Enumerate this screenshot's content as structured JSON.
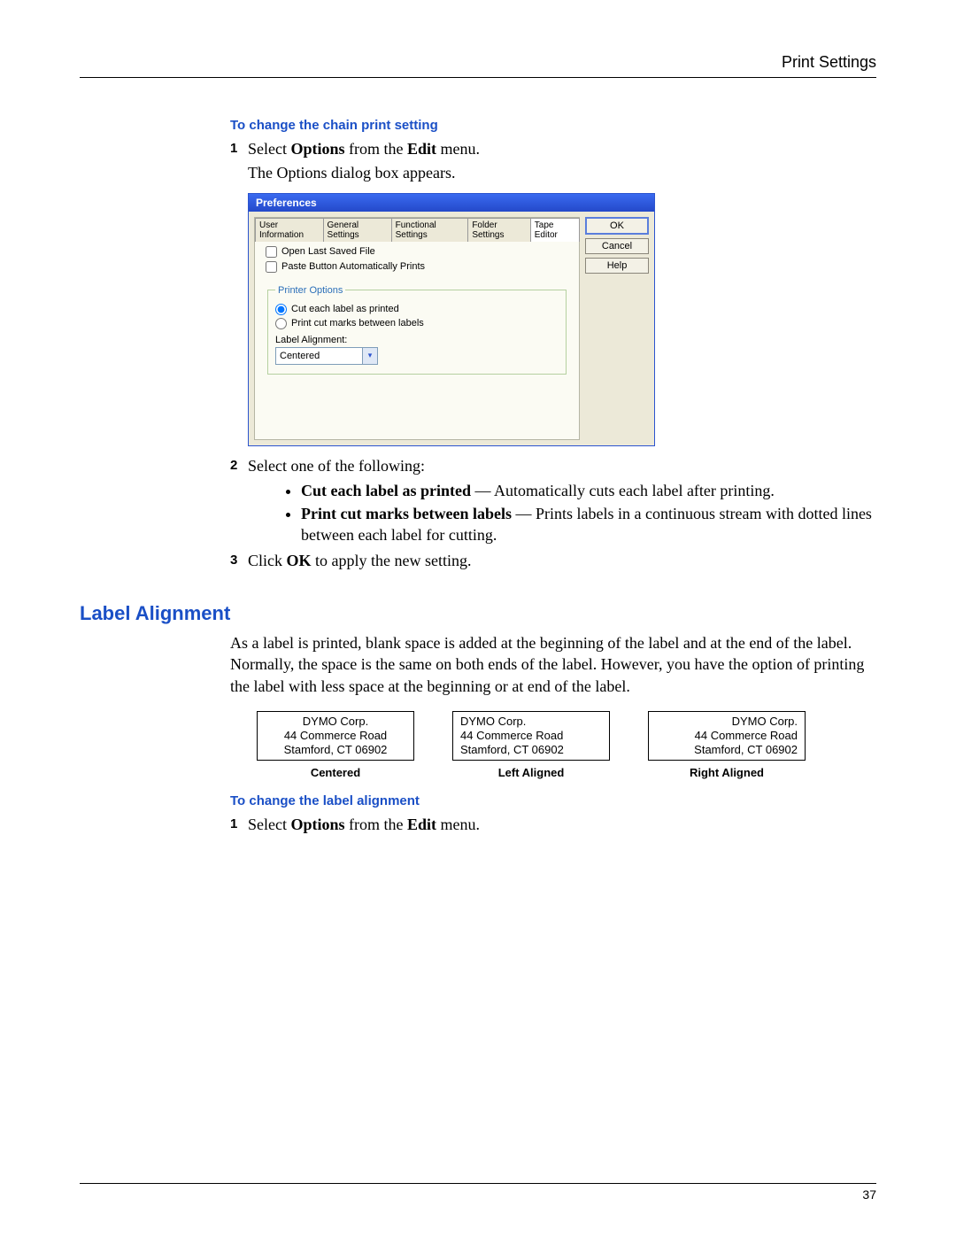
{
  "header": {
    "title": "Print Settings"
  },
  "task1": {
    "title": "To change the chain print setting",
    "step1_prefix": "Select ",
    "step1_b1": "Options",
    "step1_mid": " from the ",
    "step1_b2": "Edit",
    "step1_suffix": " menu.",
    "step1_result": "The Options dialog box appears.",
    "step2": "Select one of the following:",
    "bullets": [
      {
        "b": "Cut each label as printed",
        "t": " — Automatically cuts each label after printing."
      },
      {
        "b": "Print cut marks between labels",
        "t": " — Prints labels in a continuous stream with dotted lines between each label for cutting."
      }
    ],
    "step3_prefix": "Click ",
    "step3_b": "OK",
    "step3_suffix": " to apply the new setting."
  },
  "dialog": {
    "title": "Preferences",
    "tabs": [
      "User Information",
      "General Settings",
      "Functional Settings",
      "Folder Settings",
      "Tape Editor"
    ],
    "active_tab": 4,
    "chk1": "Open Last Saved File",
    "chk2": "Paste Button Automatically Prints",
    "group_legend": "Printer Options",
    "radio1": "Cut each label as printed",
    "radio2": "Print cut marks between labels",
    "align_label": "Label Alignment:",
    "align_value": "Centered",
    "buttons": {
      "ok": "OK",
      "cancel": "Cancel",
      "help": "Help"
    }
  },
  "section2": {
    "heading": "Label Alignment",
    "para": "As a label is printed, blank space is added at the beginning of the label and at the end of the label. Normally, the space is the same on both ends of the label. However, you have the option of printing the label with less space at the beginning or at end of the label.",
    "sample": {
      "l1": "DYMO Corp.",
      "l2": "44 Commerce Road",
      "l3": "Stamford, CT 06902"
    },
    "caps": {
      "c": "Centered",
      "l": "Left Aligned",
      "r": "Right Aligned"
    },
    "task_title": "To change the label alignment",
    "step1_prefix": "Select ",
    "step1_b1": "Options",
    "step1_mid": " from the ",
    "step1_b2": "Edit",
    "step1_suffix": " menu."
  },
  "footer": {
    "pageno": "37"
  }
}
